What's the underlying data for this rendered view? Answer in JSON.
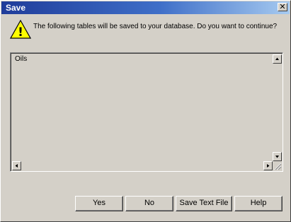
{
  "window": {
    "title": "Save",
    "close_label": "✕",
    "message": "The following tables will be saved to your database. Do you want to continue?"
  },
  "icon": {
    "name": "warning-icon",
    "glyph": "!"
  },
  "list": {
    "items": [
      "Oils"
    ]
  },
  "buttons": {
    "yes": "Yes",
    "no": "No",
    "save_text_file": "Save Text File",
    "help": "Help"
  }
}
